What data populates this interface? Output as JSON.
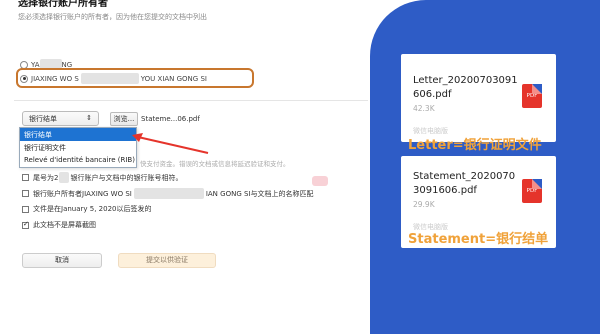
{
  "form": {
    "heading": "选择银行账户所有者",
    "subheading": "您必须选择银行账户的所有者，因为他在您提交的文档中列出",
    "owner_options": [
      {
        "prefix": "YA",
        "suffix": "NG",
        "checked": false
      },
      {
        "prefix": "JIAXING WO S",
        "suffix": "YOU XIAN GONG SI",
        "checked": true
      }
    ],
    "doc_type_select": {
      "value": "银行结单",
      "arrow": "⇕"
    },
    "browse_label": "浏览...",
    "file_name": "Stateme...06.pdf",
    "dropdown_options": [
      "银行结单",
      "银行证明文件",
      "Relevé d'identité bancaire (RIB)"
    ],
    "dropdown_selected_index": 0,
    "faded_note": "快支付资金。错误的文档或信息将延迟验证和支付。",
    "checklist": [
      {
        "label_start": "尾号为2",
        "label_end": "银行账户与文档中的银行账号相符。",
        "checked": false
      },
      {
        "label_start": "银行账户所有者JIAXING WO SI",
        "label_end": "IAN GONG SI与文档上的名称匹配",
        "checked": false
      },
      {
        "label_start": "文件是在January 5, 2020以后签发的",
        "label_end": "",
        "checked": false
      },
      {
        "label_start": "此文档不是屏幕截图",
        "label_end": "",
        "checked": true
      }
    ],
    "cancel_label": "取消",
    "submit_label": "提交以供验证"
  },
  "panel": {
    "background_color": "#2e5cc6",
    "caption_color": "#f0a23a",
    "files": [
      {
        "name_line1": "Letter_20200703091",
        "name_line2": "606.pdf",
        "size": "42.3K",
        "meta": "微信电脑版",
        "icon_label": "PDF",
        "caption": "Letter=银行证明文件"
      },
      {
        "name_line1": "Statement_2020070",
        "name_line2": "3091606.pdf",
        "size": "29.9K",
        "meta": "微信电脑版",
        "icon_label": "PDF",
        "caption": "Statement=银行结单"
      }
    ]
  }
}
